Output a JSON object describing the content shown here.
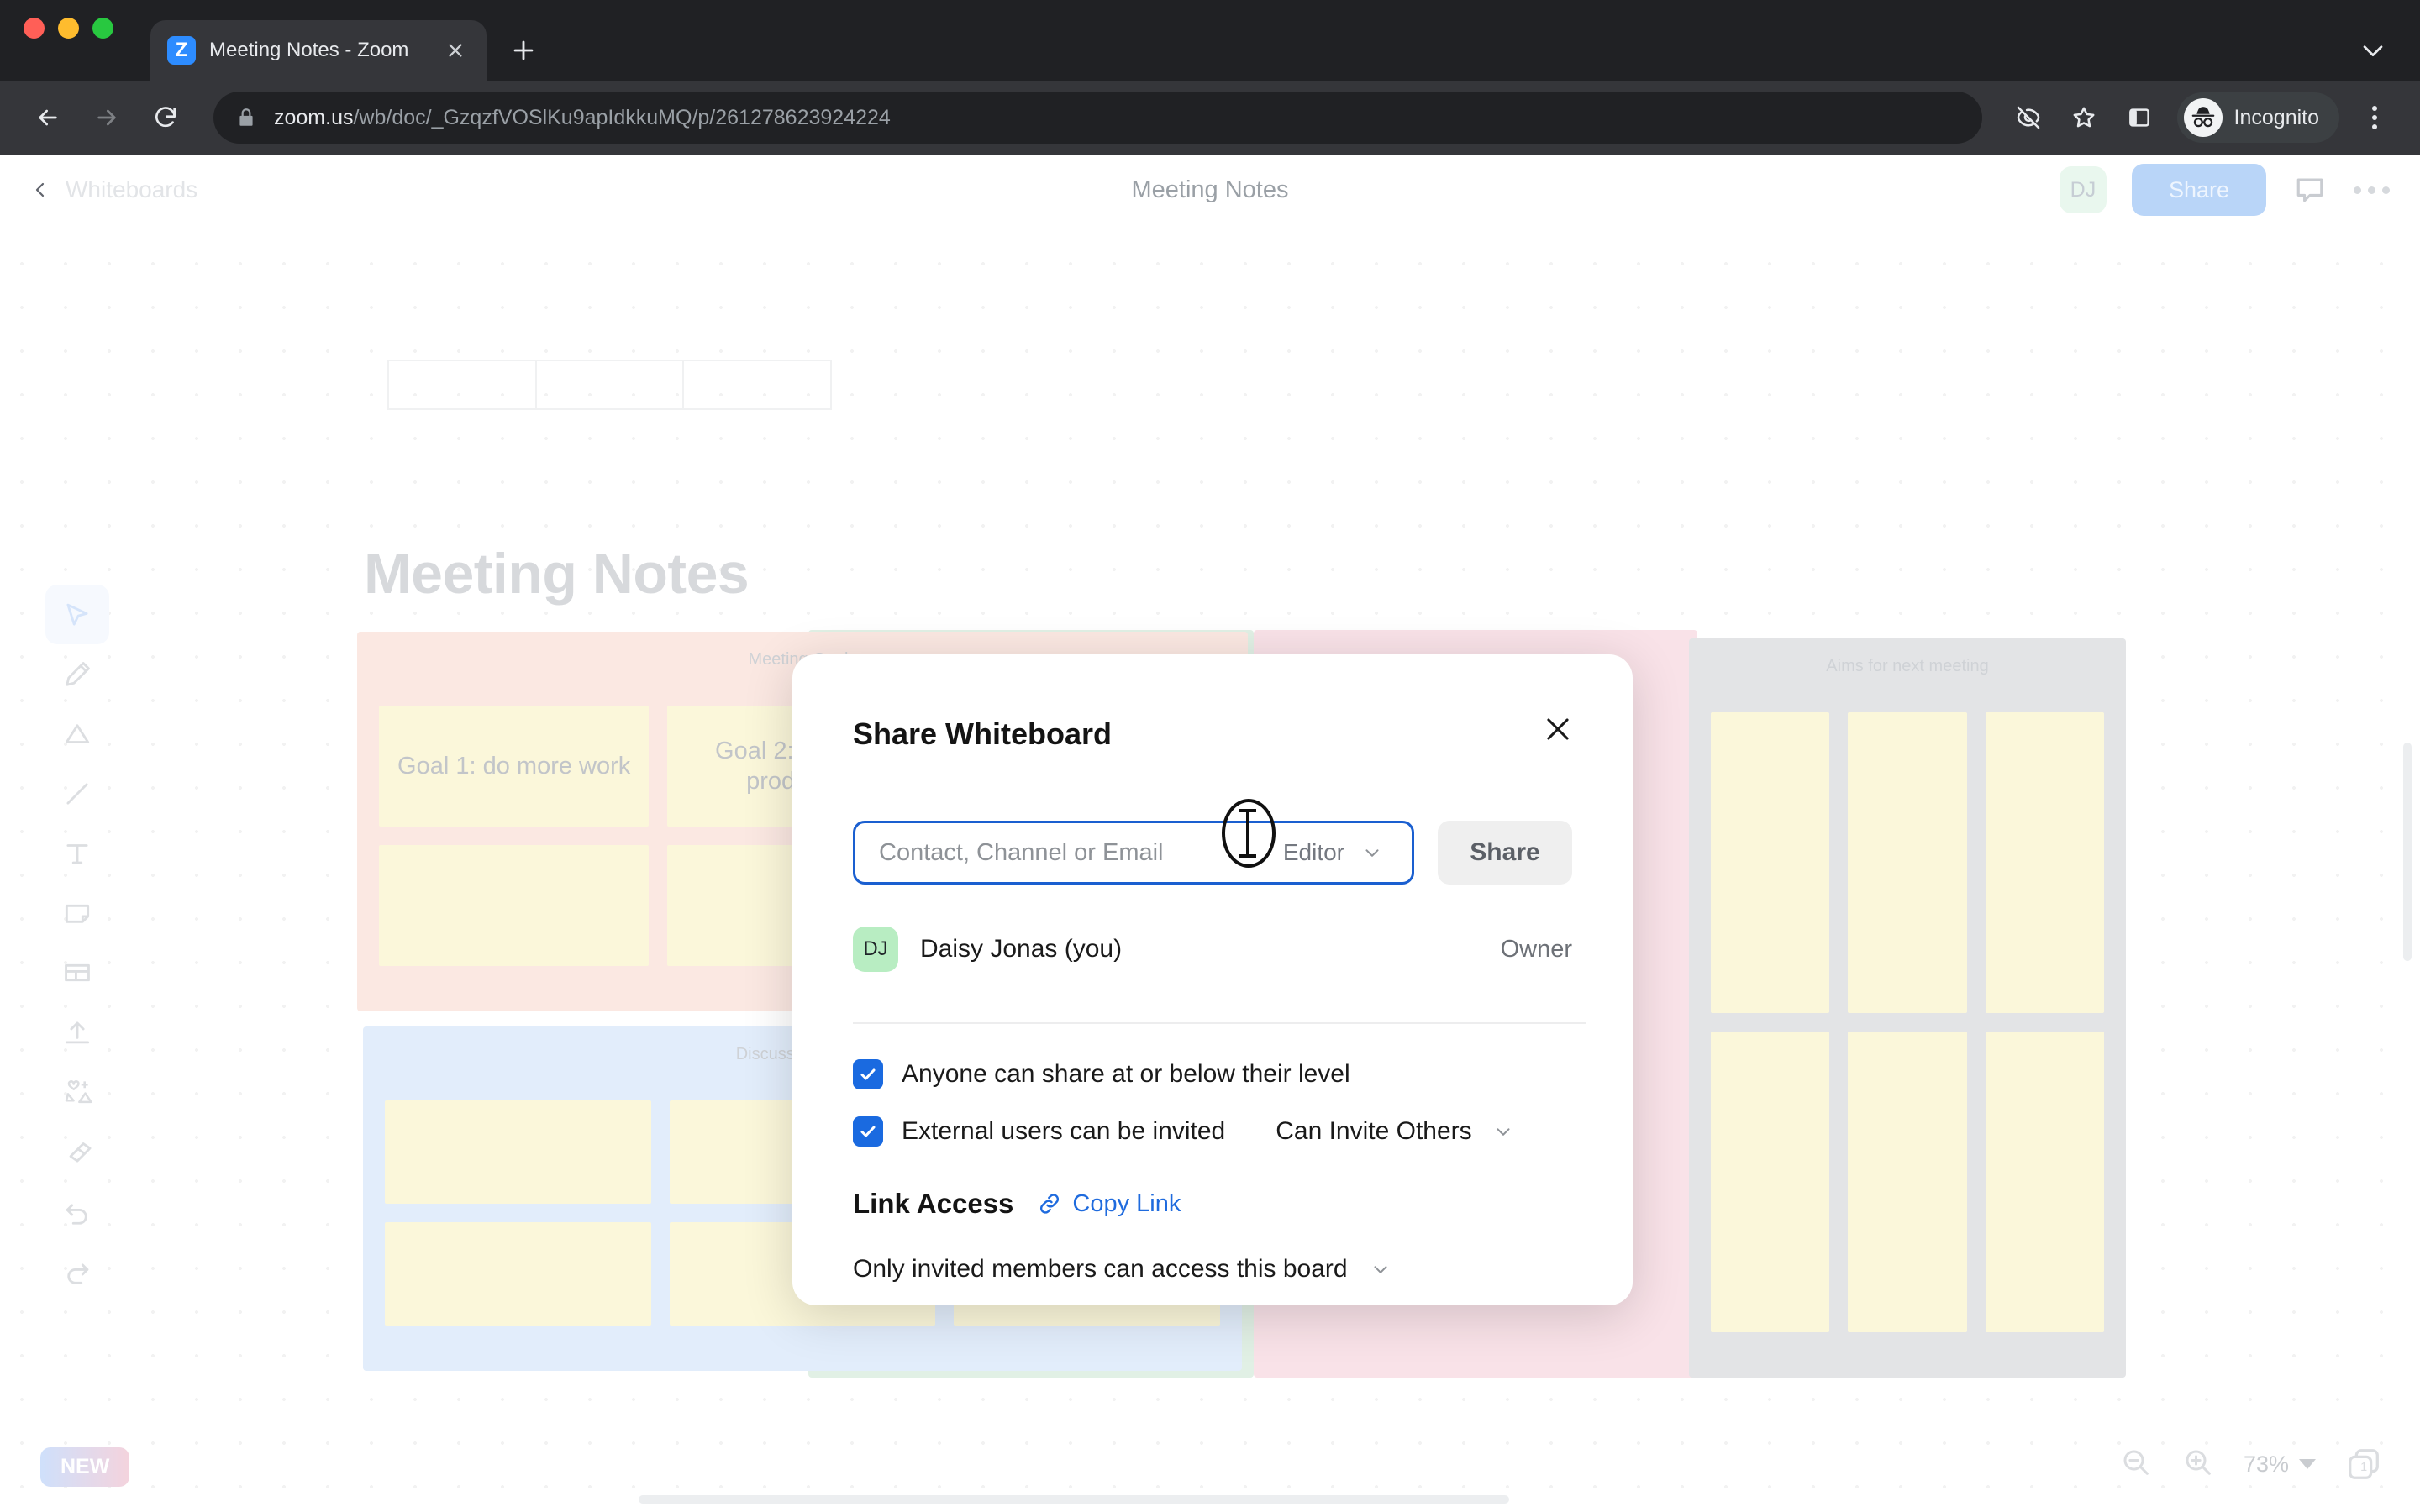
{
  "browser": {
    "tab": {
      "title": "Meeting Notes - Zoom",
      "favicon_letter": "Z",
      "close_icon": "close-icon"
    },
    "new_tab_label": "+",
    "url_host": "zoom.us",
    "url_path": "/wb/doc/_GzqzfVOSlKu9apIdkkuMQ/p/261278623924224",
    "profile_label": "Incognito",
    "icons": {
      "back": "back-arrow-icon",
      "forward": "forward-arrow-icon",
      "reload": "reload-icon",
      "lock": "lock-icon",
      "tracking_protection": "eye-slash-icon",
      "bookmark": "star-icon",
      "side_panel": "side-panel-icon",
      "menu": "kebab-menu-icon",
      "tab_list": "chevron-down-icon"
    }
  },
  "app_header": {
    "breadcrumb": "Whiteboards",
    "title": "Meeting Notes",
    "avatar_initials": "DJ",
    "share_label": "Share",
    "comment_icon": "comment-icon",
    "more_icon": "more-horizontal-icon"
  },
  "toolbar": {
    "items": [
      {
        "name": "select-tool",
        "icon": "cursor-arrow-icon",
        "active": true
      },
      {
        "name": "pen-tool",
        "icon": "pencil-icon",
        "active": false
      },
      {
        "name": "shape-tool",
        "icon": "triangle-icon",
        "active": false
      },
      {
        "name": "line-tool",
        "icon": "line-icon",
        "active": false
      },
      {
        "name": "text-tool",
        "icon": "text-t-icon",
        "active": false
      },
      {
        "name": "sticky-note-tool",
        "icon": "sticky-note-icon",
        "active": false
      },
      {
        "name": "frame-tool",
        "icon": "frame-icon",
        "active": false
      },
      {
        "name": "upload-tool",
        "icon": "upload-arrow-icon",
        "active": false
      },
      {
        "name": "sticker-tool",
        "icon": "sticker-plus-icon",
        "active": false
      },
      {
        "name": "eraser-tool",
        "icon": "eraser-icon",
        "active": false
      },
      {
        "name": "undo-tool",
        "icon": "undo-arrow-icon",
        "active": false
      },
      {
        "name": "redo-tool",
        "icon": "redo-arrow-icon",
        "active": false
      }
    ]
  },
  "canvas": {
    "board_title": "Meeting Notes",
    "panels": [
      {
        "name": "meeting-goals",
        "label": "Meeting Goals",
        "color": "#fbe8e2",
        "notes": [
          "Goal 1: do more work",
          "Goal 2: be more productive",
          "",
          "",
          "",
          ""
        ]
      },
      {
        "name": "discussion-topics",
        "label": "Discussion Topics",
        "color": "#e2edfb",
        "notes": [
          "",
          "",
          "",
          "",
          "",
          ""
        ]
      },
      {
        "name": "green-panel",
        "label": "",
        "color": "#e1f0e5",
        "notes": []
      },
      {
        "name": "pink-panel",
        "label": "",
        "color": "#f9e2e8",
        "notes": []
      },
      {
        "name": "aims-for-next-meeting",
        "label": "Aims for next meeting",
        "color": "#e3e4e6",
        "notes": [
          "",
          "",
          "",
          "",
          "",
          ""
        ]
      }
    ]
  },
  "footer": {
    "new_badge": "NEW",
    "zoom_out_icon": "zoom-out-icon",
    "zoom_in_icon": "zoom-in-icon",
    "zoom_level": "73%",
    "page_count": "1",
    "pages_icon": "pages-icon"
  },
  "modal": {
    "title": "Share Whiteboard",
    "close_icon": "close-icon",
    "invite": {
      "placeholder": "Contact, Channel or Email",
      "value": "",
      "role": "Editor",
      "role_chevron": "chevron-down-icon",
      "submit_label": "Share"
    },
    "members": [
      {
        "initials": "DJ",
        "name": "Daisy Jonas (you)",
        "role": "Owner"
      }
    ],
    "checkboxes": [
      {
        "name": "anyone-can-share",
        "label": "Anyone can share at or below their level",
        "checked": true
      },
      {
        "name": "external-users-invited",
        "label": "External users can be invited",
        "checked": true,
        "select_value": "Can Invite Others"
      }
    ],
    "link_access": {
      "title": "Link Access",
      "copy_label": "Copy Link",
      "link_icon": "link-chain-icon",
      "scope": "Only invited members can access this board",
      "scope_chevron": "chevron-down-icon"
    }
  },
  "colors": {
    "accent_blue": "#1a6ae0",
    "link_blue": "#1f6bde",
    "share_btn_bg": "#b9d5f8",
    "note_yellow": "#fbf7da",
    "avatar_green": "#b8edc2"
  }
}
